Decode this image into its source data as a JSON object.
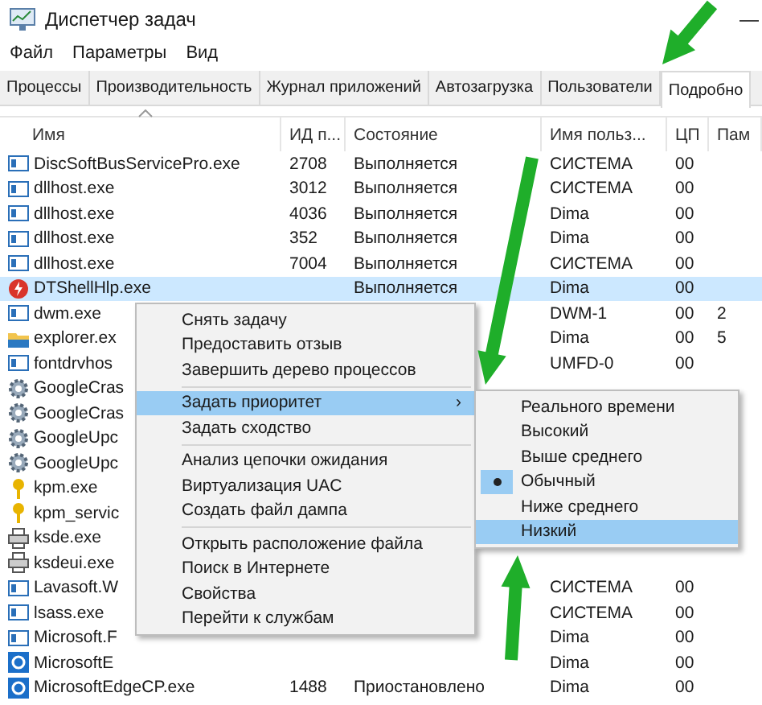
{
  "window": {
    "title": "Диспетчер задач",
    "minimize": "—"
  },
  "menu": [
    "Файл",
    "Параметры",
    "Вид"
  ],
  "tabs": [
    {
      "label": "Процессы",
      "selected": false
    },
    {
      "label": "Производительность",
      "selected": false
    },
    {
      "label": "Журнал приложений",
      "selected": false
    },
    {
      "label": "Автозагрузка",
      "selected": false
    },
    {
      "label": "Пользователи",
      "selected": false
    },
    {
      "label": "Подробно",
      "selected": true
    }
  ],
  "table": {
    "columns": [
      "Имя",
      "ИД п...",
      "Состояние",
      "Имя польз...",
      "ЦП",
      "Пам"
    ],
    "rows": [
      {
        "kind": "app",
        "name": "DiscSoftBusServicePro.exe",
        "pid": "2708",
        "state": "Выполняется",
        "user": "СИСТЕМА",
        "cpu": "00",
        "selected": false
      },
      {
        "kind": "app",
        "name": "dllhost.exe",
        "pid": "3012",
        "state": "Выполняется",
        "user": "СИСТЕМА",
        "cpu": "00",
        "selected": false
      },
      {
        "kind": "app",
        "name": "dllhost.exe",
        "pid": "4036",
        "state": "Выполняется",
        "user": "Dima",
        "cpu": "00",
        "selected": false
      },
      {
        "kind": "app",
        "name": "dllhost.exe",
        "pid": "352",
        "state": "Выполняется",
        "user": "Dima",
        "cpu": "00",
        "selected": false
      },
      {
        "kind": "app",
        "name": "dllhost.exe",
        "pid": "7004",
        "state": "Выполняется",
        "user": "СИСТЕМА",
        "cpu": "00",
        "selected": false
      },
      {
        "kind": "power",
        "name": "DTShellHlp.exe",
        "state": "Выполняется",
        "user": "Dima",
        "cpu": "00",
        "selected": true
      },
      {
        "kind": "app",
        "name": "dwm.exe",
        "user": "DWM-1",
        "cpu": "00",
        "mem": "2",
        "selected": false
      },
      {
        "kind": "folder",
        "name": "explorer.ex",
        "user": "Dima",
        "cpu": "00",
        "mem": "5",
        "selected": false
      },
      {
        "kind": "app",
        "name": "fontdrvhos",
        "user": "UMFD-0",
        "cpu": "00",
        "selected": false
      },
      {
        "kind": "gear",
        "name": "GoogleCras",
        "selected": false
      },
      {
        "kind": "gear",
        "name": "GoogleCras",
        "selected": false
      },
      {
        "kind": "gear",
        "name": "GoogleUpc",
        "selected": false
      },
      {
        "kind": "gear",
        "name": "GoogleUpc",
        "selected": false
      },
      {
        "kind": "key",
        "name": "kpm.exe",
        "selected": false
      },
      {
        "kind": "key",
        "name": "kpm_servic",
        "selected": false
      },
      {
        "kind": "printer",
        "name": "ksde.exe",
        "selected": false
      },
      {
        "kind": "printer",
        "name": "ksdeui.exe",
        "selected": false
      },
      {
        "kind": "app",
        "name": "Lavasoft.W",
        "user": "СИСТЕМА",
        "cpu": "00",
        "selected": false
      },
      {
        "kind": "app",
        "name": "lsass.exe",
        "user": "СИСТЕМА",
        "cpu": "00",
        "selected": false
      },
      {
        "kind": "app",
        "name": "Microsoft.F",
        "user": "Dima",
        "cpu": "00",
        "selected": false
      },
      {
        "kind": "browser",
        "name": "MicrosoftE",
        "user": "Dima",
        "cpu": "00",
        "selected": false
      },
      {
        "kind": "browser",
        "name": "MicrosoftEdgeCP.exe",
        "pid": "1488",
        "state": "Приостановлено",
        "user": "Dima",
        "cpu": "00",
        "selected": false
      }
    ]
  },
  "context_menu": {
    "groups": [
      [
        {
          "label": "Снять задачу",
          "selected": false
        },
        {
          "label": "Предоставить отзыв",
          "selected": false
        },
        {
          "label": "Завершить дерево процессов",
          "selected": false
        }
      ],
      [
        {
          "label": "Задать приоритет",
          "selected": true,
          "submenu": true
        },
        {
          "label": "Задать сходство",
          "selected": false
        }
      ],
      [
        {
          "label": "Анализ цепочки ожидания",
          "selected": false
        },
        {
          "label": "Виртуализация UAC",
          "selected": false
        },
        {
          "label": "Создать файл дампа",
          "selected": false
        }
      ],
      [
        {
          "label": "Открыть расположение файла",
          "selected": false
        },
        {
          "label": "Поиск в Интернете",
          "selected": false
        },
        {
          "label": "Свойства",
          "selected": false
        },
        {
          "label": "Перейти к службам",
          "selected": false
        }
      ]
    ],
    "arrow": "›"
  },
  "priority_menu": [
    {
      "label": "Реального времени",
      "checked": false,
      "selected": false
    },
    {
      "label": "Высокий",
      "checked": false,
      "selected": false
    },
    {
      "label": "Выше среднего",
      "checked": false,
      "selected": false
    },
    {
      "label": "Обычный",
      "checked": true,
      "selected": false
    },
    {
      "label": "Ниже среднего",
      "checked": false,
      "selected": false
    },
    {
      "label": "Низкий",
      "checked": false,
      "selected": true
    }
  ]
}
